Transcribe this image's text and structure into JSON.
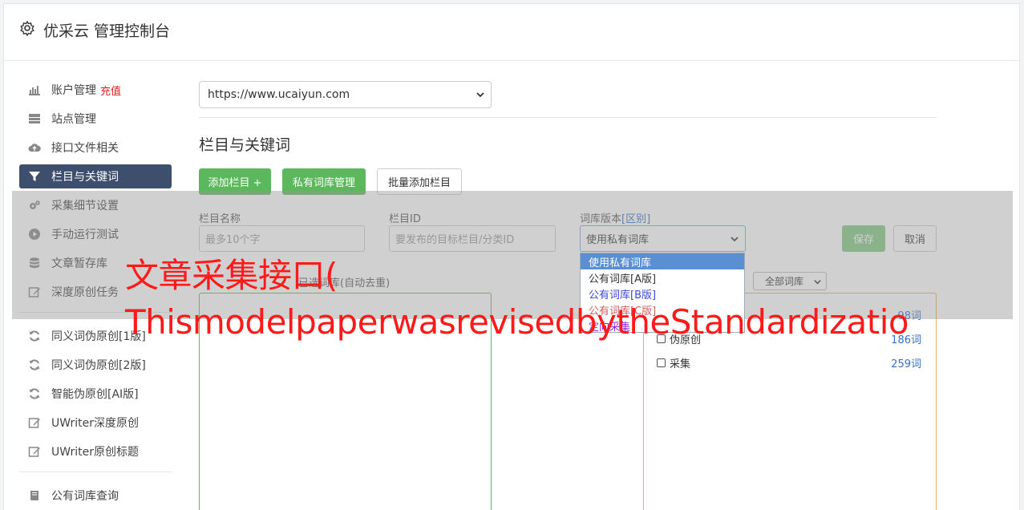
{
  "app": {
    "title": "优采云 管理控制台",
    "icon": "gear-icon"
  },
  "sidebar": {
    "items": [
      {
        "label": "账户管理",
        "badge": "充值",
        "icon": "bar-chart-icon"
      },
      {
        "label": "站点管理",
        "icon": "server-icon"
      },
      {
        "label": "接口文件相关",
        "icon": "cloud-upload-icon"
      },
      {
        "label": "栏目与关键词",
        "icon": "filter-icon",
        "active": true
      },
      {
        "label": "采集细节设置",
        "icon": "cogs-icon"
      },
      {
        "label": "手动运行测试",
        "icon": "play-circle-icon"
      },
      {
        "label": "文章暂存库",
        "icon": "database-icon"
      },
      {
        "label": "深度原创任务",
        "icon": "edit-icon"
      },
      {
        "label": "同义词伪原创[1版]",
        "icon": "refresh-icon"
      },
      {
        "label": "同义词伪原创[2版]",
        "icon": "refresh-icon"
      },
      {
        "label": "智能伪原创[AI版]",
        "icon": "refresh-icon"
      },
      {
        "label": "UWriter深度原创",
        "icon": "edit-icon"
      },
      {
        "label": "UWriter原创标题",
        "icon": "edit-icon"
      },
      {
        "label": "公有词库查询",
        "icon": "book-icon"
      }
    ]
  },
  "main": {
    "site_select": "https://www.ucaiyun.com",
    "section_title": "栏目与关键词",
    "buttons": {
      "add_column": "添加栏目 +",
      "private_lib": "私有词库管理",
      "batch_add": "批量添加栏目"
    },
    "form": {
      "name_label": "栏目名称",
      "name_placeholder": "最多10个字",
      "id_label": "栏目ID",
      "id_placeholder": "要发布的目标栏目/分类ID",
      "version_label": "词库版本",
      "version_link": "[区别]",
      "version_value": "使用私有词库",
      "save": "保存",
      "cancel": "取消"
    },
    "dropdown_options": [
      "使用私有词库",
      "公有词库[A版]",
      "公有词库[B版]",
      "公有词库[C版]",
      "定向采集"
    ],
    "selected_label": "已选词库(自动去重)",
    "all_libs_select": "全部词库",
    "libraries": [
      {
        "name": "",
        "count": "98词"
      },
      {
        "name": "伪原创",
        "count": "186词"
      },
      {
        "name": "采集",
        "count": "259词"
      }
    ]
  },
  "watermark": {
    "line1": "文章采集接口(",
    "line2": "ThismodelpaperwasrevisedbytheStandardizatio"
  },
  "colors": {
    "accent_green": "#5cb85c",
    "active_nav": "#3d4f6c",
    "badge_red": "#e02020",
    "watermark_red": "#ff1a1a"
  }
}
